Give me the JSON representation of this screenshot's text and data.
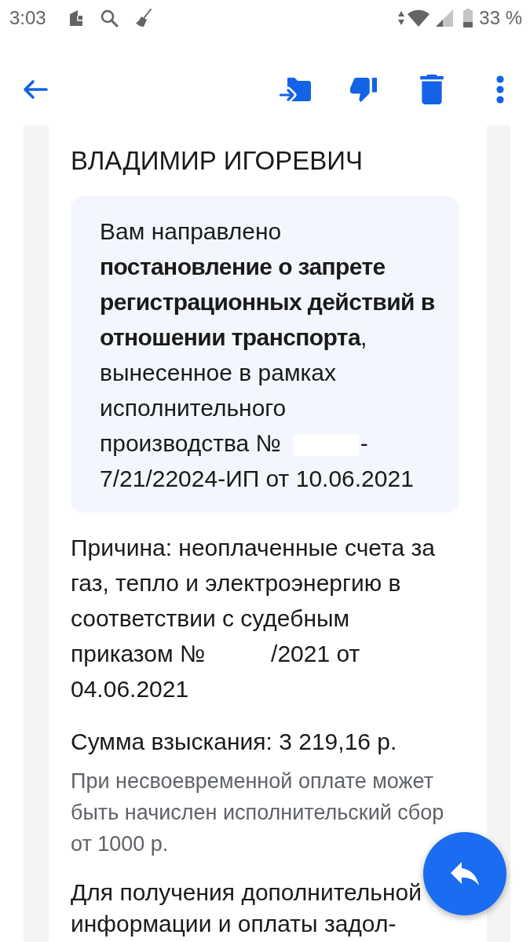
{
  "status_bar": {
    "time": "3:03",
    "battery": "33 %"
  },
  "letter": {
    "heading": "ВЛАДИМИР ИГОРЕВИЧ",
    "notice": {
      "before": "Вам направлено **постановление о запрете регистрационных действий в отношении транспорта**, вынесенное в рамках исполнительного производства №",
      "after": "-7/21/22024-ИП от 10.06.2021"
    },
    "reason": {
      "before": "Причина: неоплаченные счета за газ, тепло и электроэнергию в соответствии с судебным приказом №",
      "after": "/2021 от 04.06.2021"
    },
    "amount": "Сумма взыскания: 3 219,16 р.",
    "fee_note": "При несвоевременной оплате может быть начислен исполнительский сбор от 1000 р.",
    "info": "Для получения дополнительной информации и оплаты задол-"
  }
}
